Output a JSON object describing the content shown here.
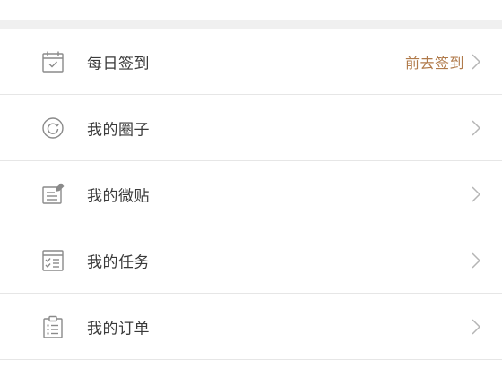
{
  "menu": {
    "items": [
      {
        "label": "每日签到",
        "action": "前去签到",
        "icon": "calendar-check-icon"
      },
      {
        "label": "我的圈子",
        "action": "",
        "icon": "circle-refresh-icon"
      },
      {
        "label": "我的微贴",
        "action": "",
        "icon": "edit-note-icon"
      },
      {
        "label": "我的任务",
        "action": "",
        "icon": "task-list-icon"
      },
      {
        "label": "我的订单",
        "action": "",
        "icon": "clipboard-list-icon"
      }
    ]
  },
  "colors": {
    "action_text": "#b07a4a",
    "label_text": "#3a3a3a",
    "icon_stroke": "#8a8a8a",
    "chevron": "#b5b5b5",
    "divider": "#e6e6e6",
    "band": "#f0f0f0"
  }
}
